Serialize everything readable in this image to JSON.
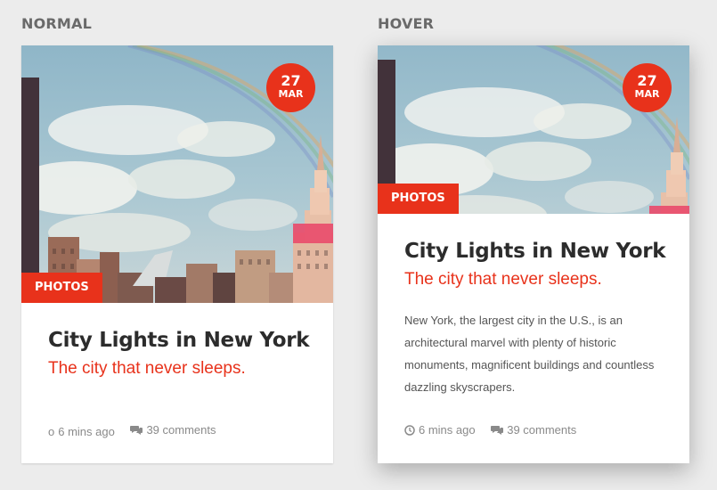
{
  "normal": {
    "section_label": "NORMAL",
    "card": {
      "date_day": "27",
      "date_month": "MAR",
      "category": "PHOTOS",
      "title": "City Lights in New York",
      "subtitle": "The city that never sleeps.",
      "time_ago": "6 mins ago",
      "time_icon_glyph": "o",
      "comments": "39 comments"
    }
  },
  "hover": {
    "section_label": "HOVER",
    "card": {
      "date_day": "27",
      "date_month": "MAR",
      "category": "PHOTOS",
      "title": "City Lights in New York",
      "subtitle": "The city that never sleeps.",
      "description": "New York, the largest city in the U.S., is an architectural marvel with plenty of historic monuments, magnificent buildings and countless dazzling skyscrapers.",
      "time_ago": "6 mins ago",
      "comments": "39 comments"
    }
  },
  "icons": {
    "time": "clock-icon",
    "comments": "comments-icon"
  },
  "colors": {
    "accent": "#e8321b",
    "title": "#2c2c2c",
    "meta": "#8a8a8a",
    "background": "#ececec"
  }
}
